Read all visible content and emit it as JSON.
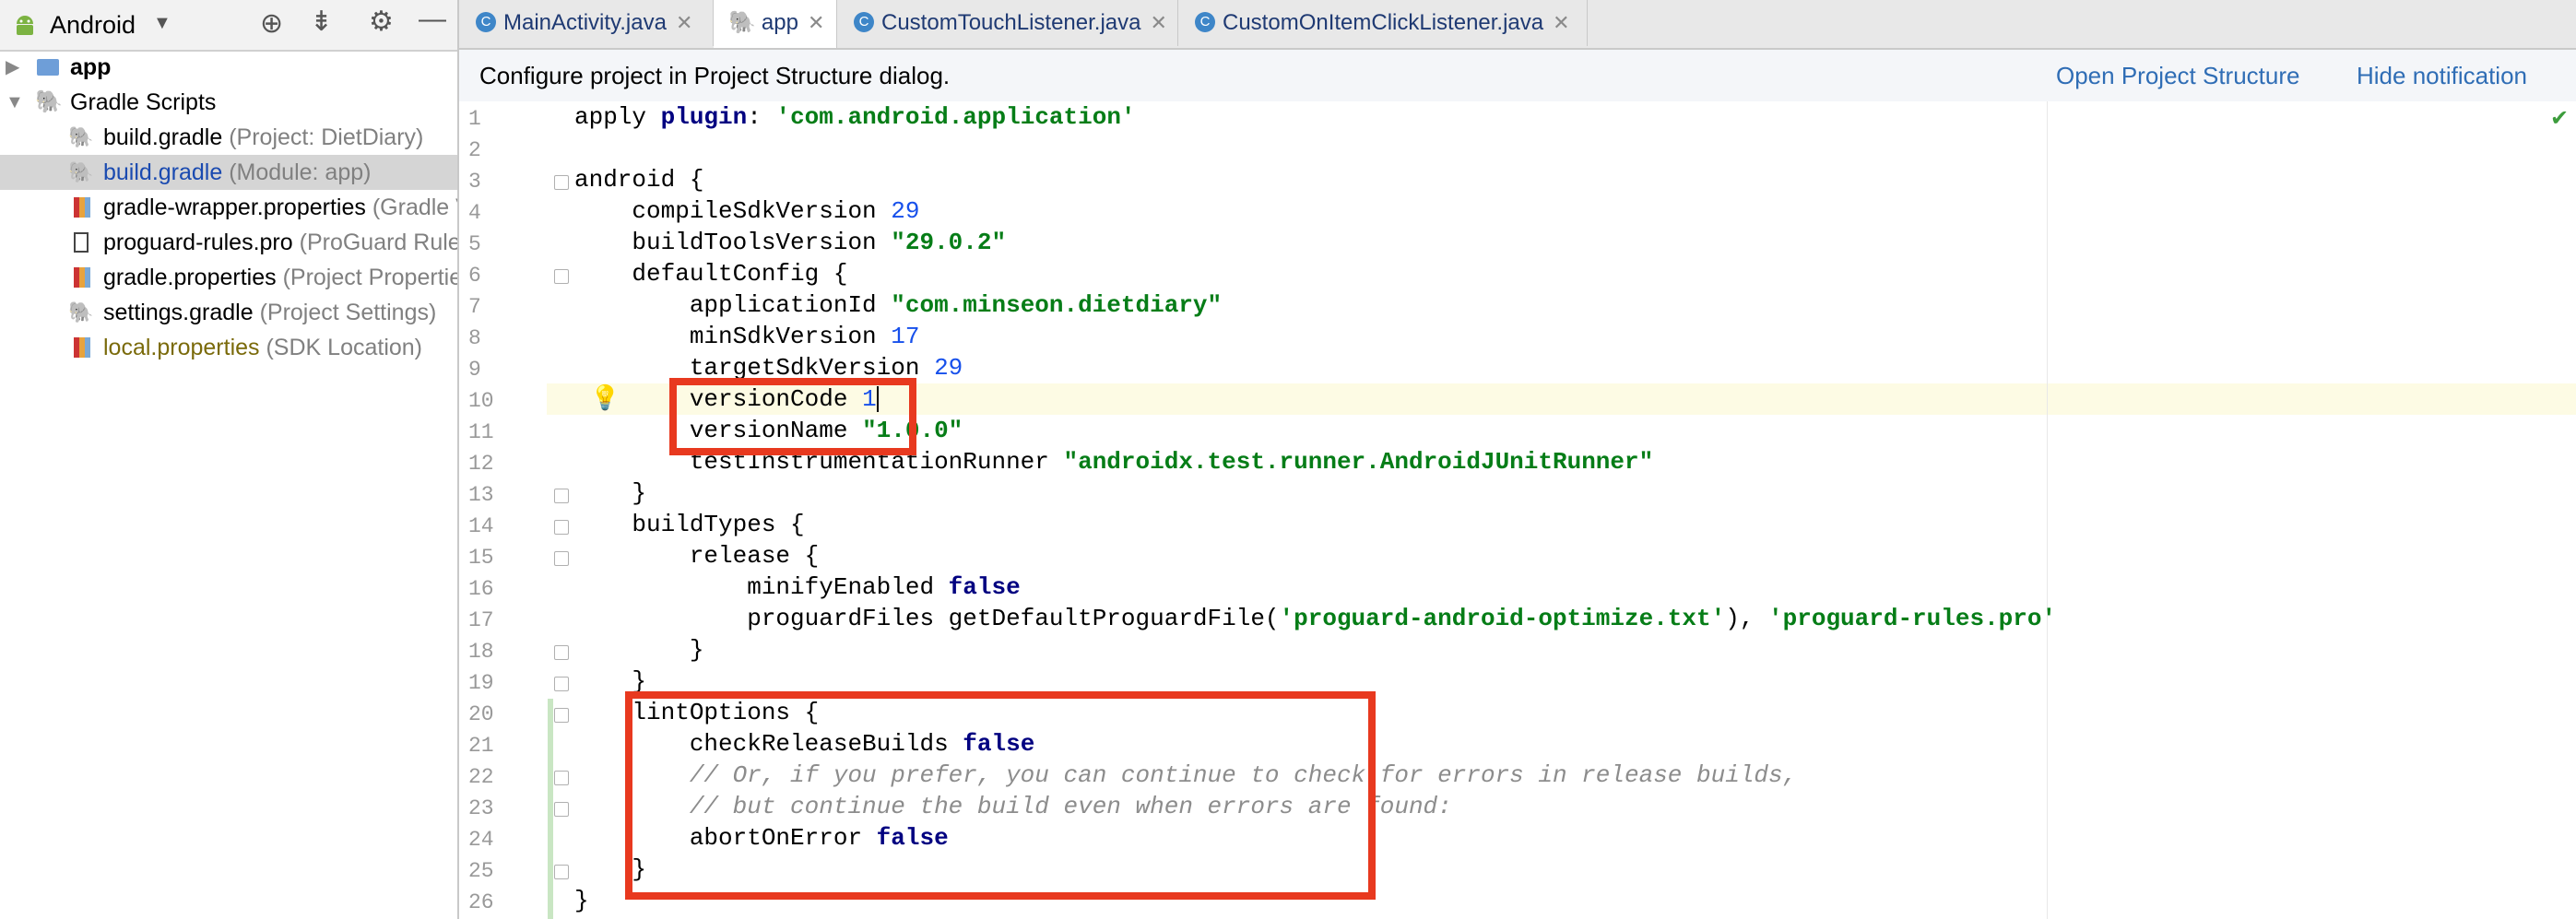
{
  "sidebar": {
    "view_selector": "Android",
    "tree": [
      {
        "label": "app",
        "hint": "",
        "style": "bold"
      },
      {
        "label": "Gradle Scripts",
        "hint": ""
      },
      {
        "label": "build.gradle",
        "hint": "(Project: DietDiary)"
      },
      {
        "label": "build.gradle",
        "hint": "(Module: app)",
        "selected": true
      },
      {
        "label": "gradle-wrapper.properties",
        "hint": "(Gradle Version)"
      },
      {
        "label": "proguard-rules.pro",
        "hint": "(ProGuard Rules for app)"
      },
      {
        "label": "gradle.properties",
        "hint": "(Project Properties)"
      },
      {
        "label": "settings.gradle",
        "hint": "(Project Settings)"
      },
      {
        "label": "local.properties",
        "hint": "(SDK Location)"
      }
    ]
  },
  "tabs": [
    {
      "label": "MainActivity.java",
      "icon": "class-icon"
    },
    {
      "label": "app",
      "icon": "gradle-icon",
      "active": true
    },
    {
      "label": "CustomTouchListener.java",
      "icon": "class-icon"
    },
    {
      "label": "CustomOnItemClickListener.java",
      "icon": "class-icon"
    }
  ],
  "notification": {
    "text": "Configure project in Project Structure dialog.",
    "open_link": "Open Project Structure",
    "hide_link": "Hide notification"
  },
  "editor": {
    "line_numbers": [
      "1",
      "2",
      "3",
      "4",
      "5",
      "6",
      "7",
      "8",
      "9",
      "10",
      "11",
      "12",
      "13",
      "14",
      "15",
      "16",
      "17",
      "18",
      "19",
      "20",
      "21",
      "22",
      "23",
      "24",
      "25",
      "26"
    ],
    "current_line": 10
  }
}
